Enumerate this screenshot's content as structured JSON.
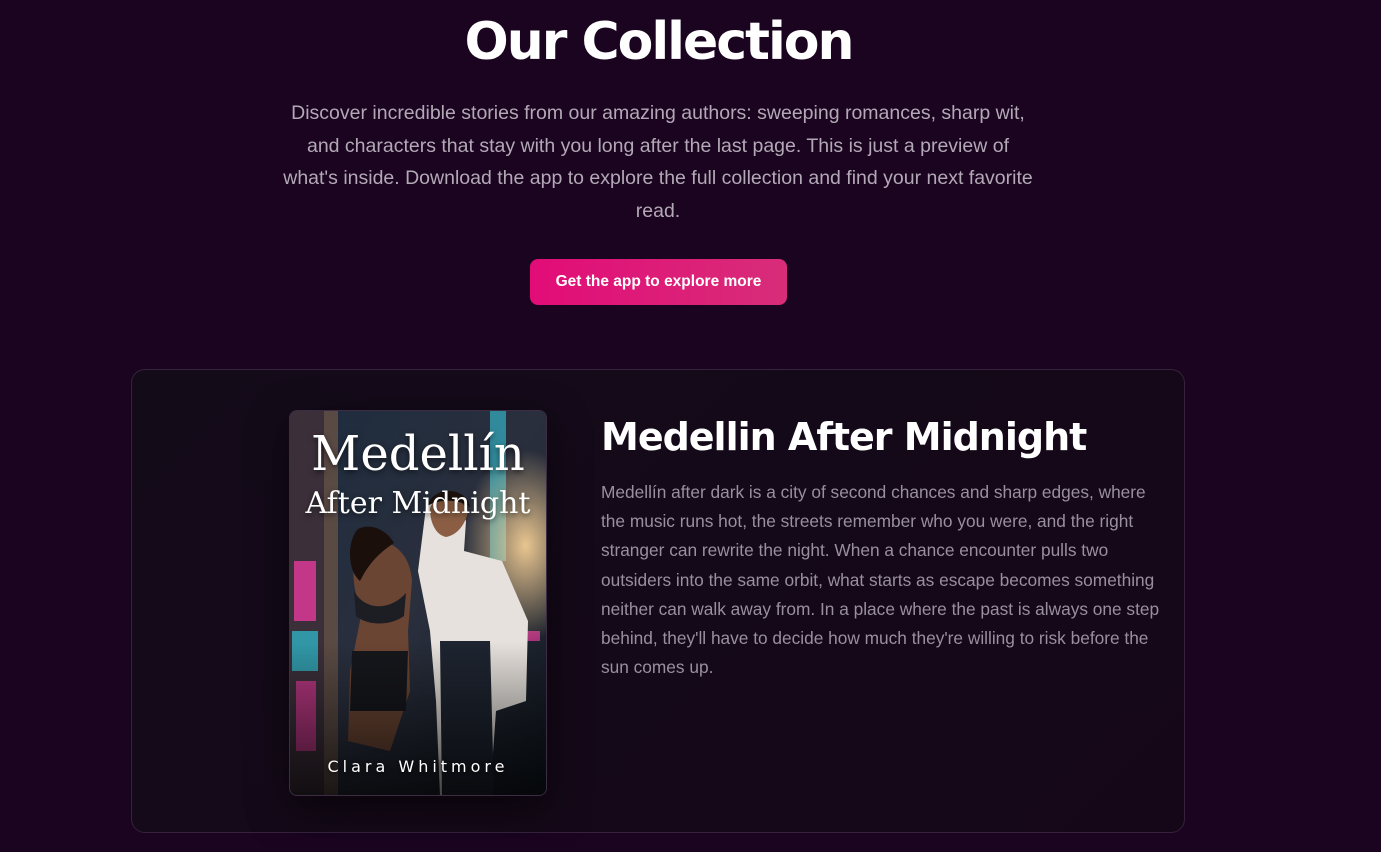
{
  "header": {
    "title": "Our Collection",
    "intro": "Discover incredible stories from our amazing authors: sweeping romances, sharp wit, and characters that stay with you long after the last page. This is just a preview of what's inside. Download the app to explore the full collection and find your next favorite read.",
    "cta_label": "Get the app to explore more"
  },
  "book": {
    "cover_title_line1": "Medellín",
    "cover_title_line2": "After Midnight",
    "cover_author": "Clara Whitmore",
    "title": "Medellin After Midnight",
    "description": "Medellín after dark is a city of second chances and sharp edges, where the music runs hot, the streets remember who you were, and the right stranger can rewrite the night. When a chance encounter pulls two outsiders into the same orbit, what starts as escape becomes something neither can walk away from. In a place where the past is always one step behind, they'll have to decide how much they're willing to risk before the sun comes up."
  },
  "colors": {
    "background": "#1a0420",
    "accent": "#e20c77",
    "title_text": "#ffffff",
    "body_text": "#b3a9b6",
    "card_border": "#35233b"
  }
}
